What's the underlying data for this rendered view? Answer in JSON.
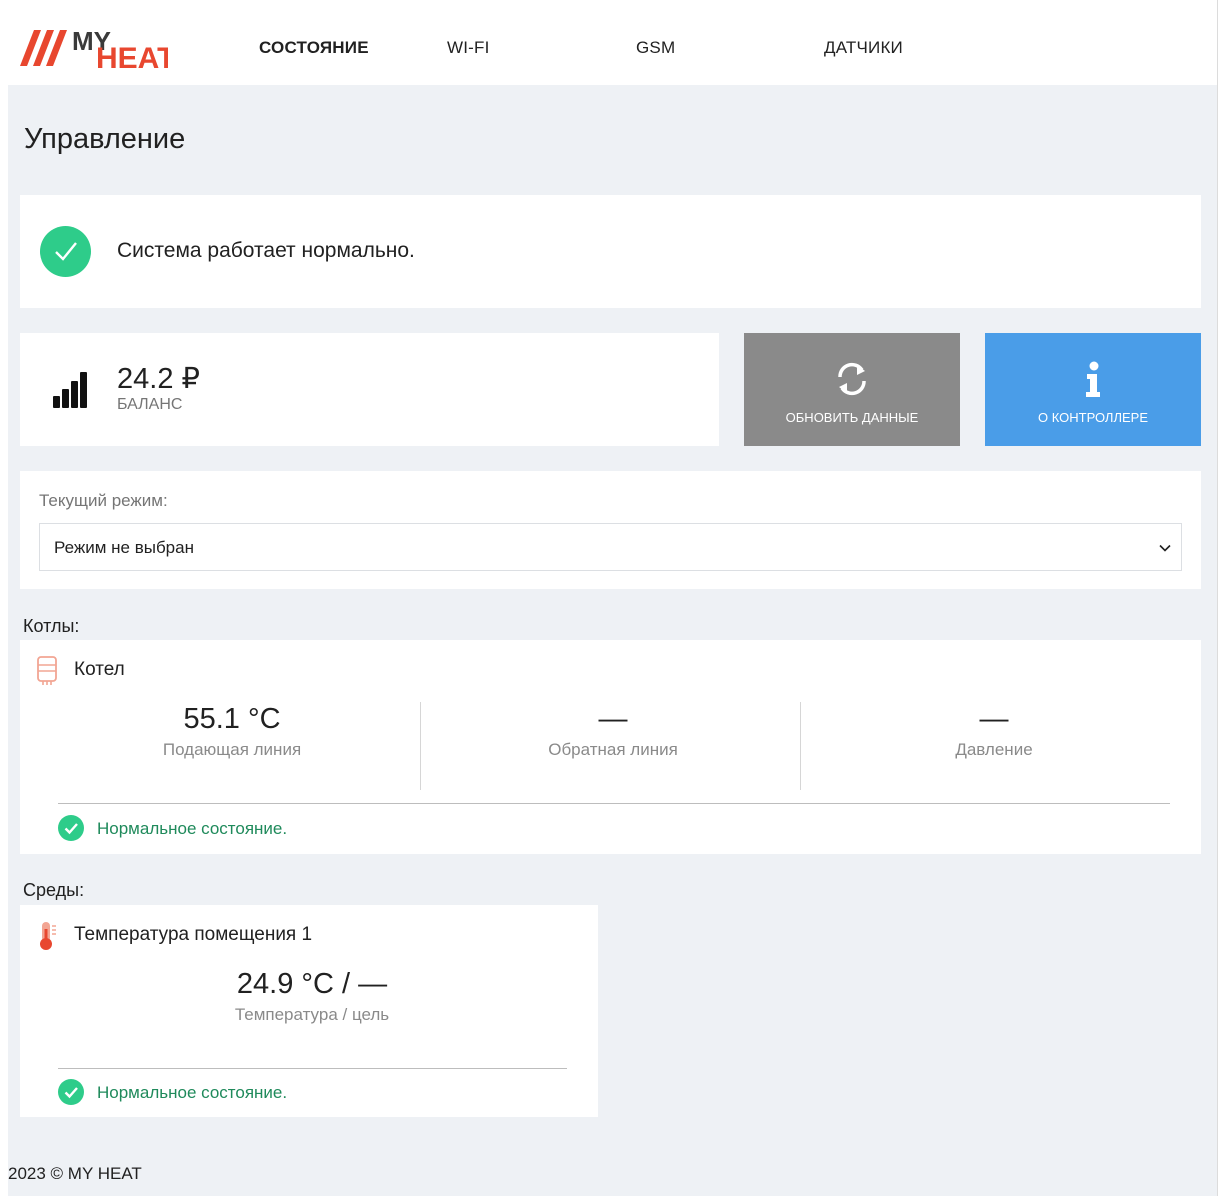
{
  "brand": {
    "logo_text_top": "MY",
    "logo_text_bottom": "HEAT",
    "colors": {
      "accent": "#e8472f",
      "dark": "#3a3a3a"
    }
  },
  "nav": {
    "items": [
      {
        "label": "СОСТОЯНИЕ",
        "active": true
      },
      {
        "label": "WI-FI",
        "active": false
      },
      {
        "label": "GSM",
        "active": false
      },
      {
        "label": "ДАТЧИКИ",
        "active": false
      }
    ]
  },
  "page": {
    "title": "Управление"
  },
  "status": {
    "text": "Система работает нормально.",
    "icon": "check-circle-icon",
    "color": "#2ecc8a"
  },
  "balance": {
    "value": "24.2 ₽",
    "label": "БАЛАНС",
    "icon": "signal-strength-icon"
  },
  "actions": {
    "refresh": {
      "label": "ОБНОВИТЬ ДАННЫЕ",
      "icon": "refresh-icon",
      "color": "#8a8a8a"
    },
    "about": {
      "label": "О КОНТРОЛЛЕРЕ",
      "icon": "info-icon",
      "color": "#4a9de8"
    }
  },
  "mode": {
    "label": "Текущий режим:",
    "selected": "Режим не выбран"
  },
  "boilers": {
    "section_label": "Котлы:",
    "items": [
      {
        "name": "Котел",
        "icon": "boiler-icon",
        "metrics": [
          {
            "value": "55.1 °C",
            "label": "Подающая линия"
          },
          {
            "value": "—",
            "label": "Обратная линия"
          },
          {
            "value": "—",
            "label": "Давление"
          }
        ],
        "state": "Нормальное состояние."
      }
    ]
  },
  "environments": {
    "section_label": "Среды:",
    "items": [
      {
        "name": "Температура помещения 1",
        "icon": "thermometer-icon",
        "value": "24.9 °C / —",
        "label": "Температура / цель",
        "state": "Нормальное состояние."
      }
    ]
  },
  "footer": {
    "text": "2023 © MY HEAT"
  }
}
